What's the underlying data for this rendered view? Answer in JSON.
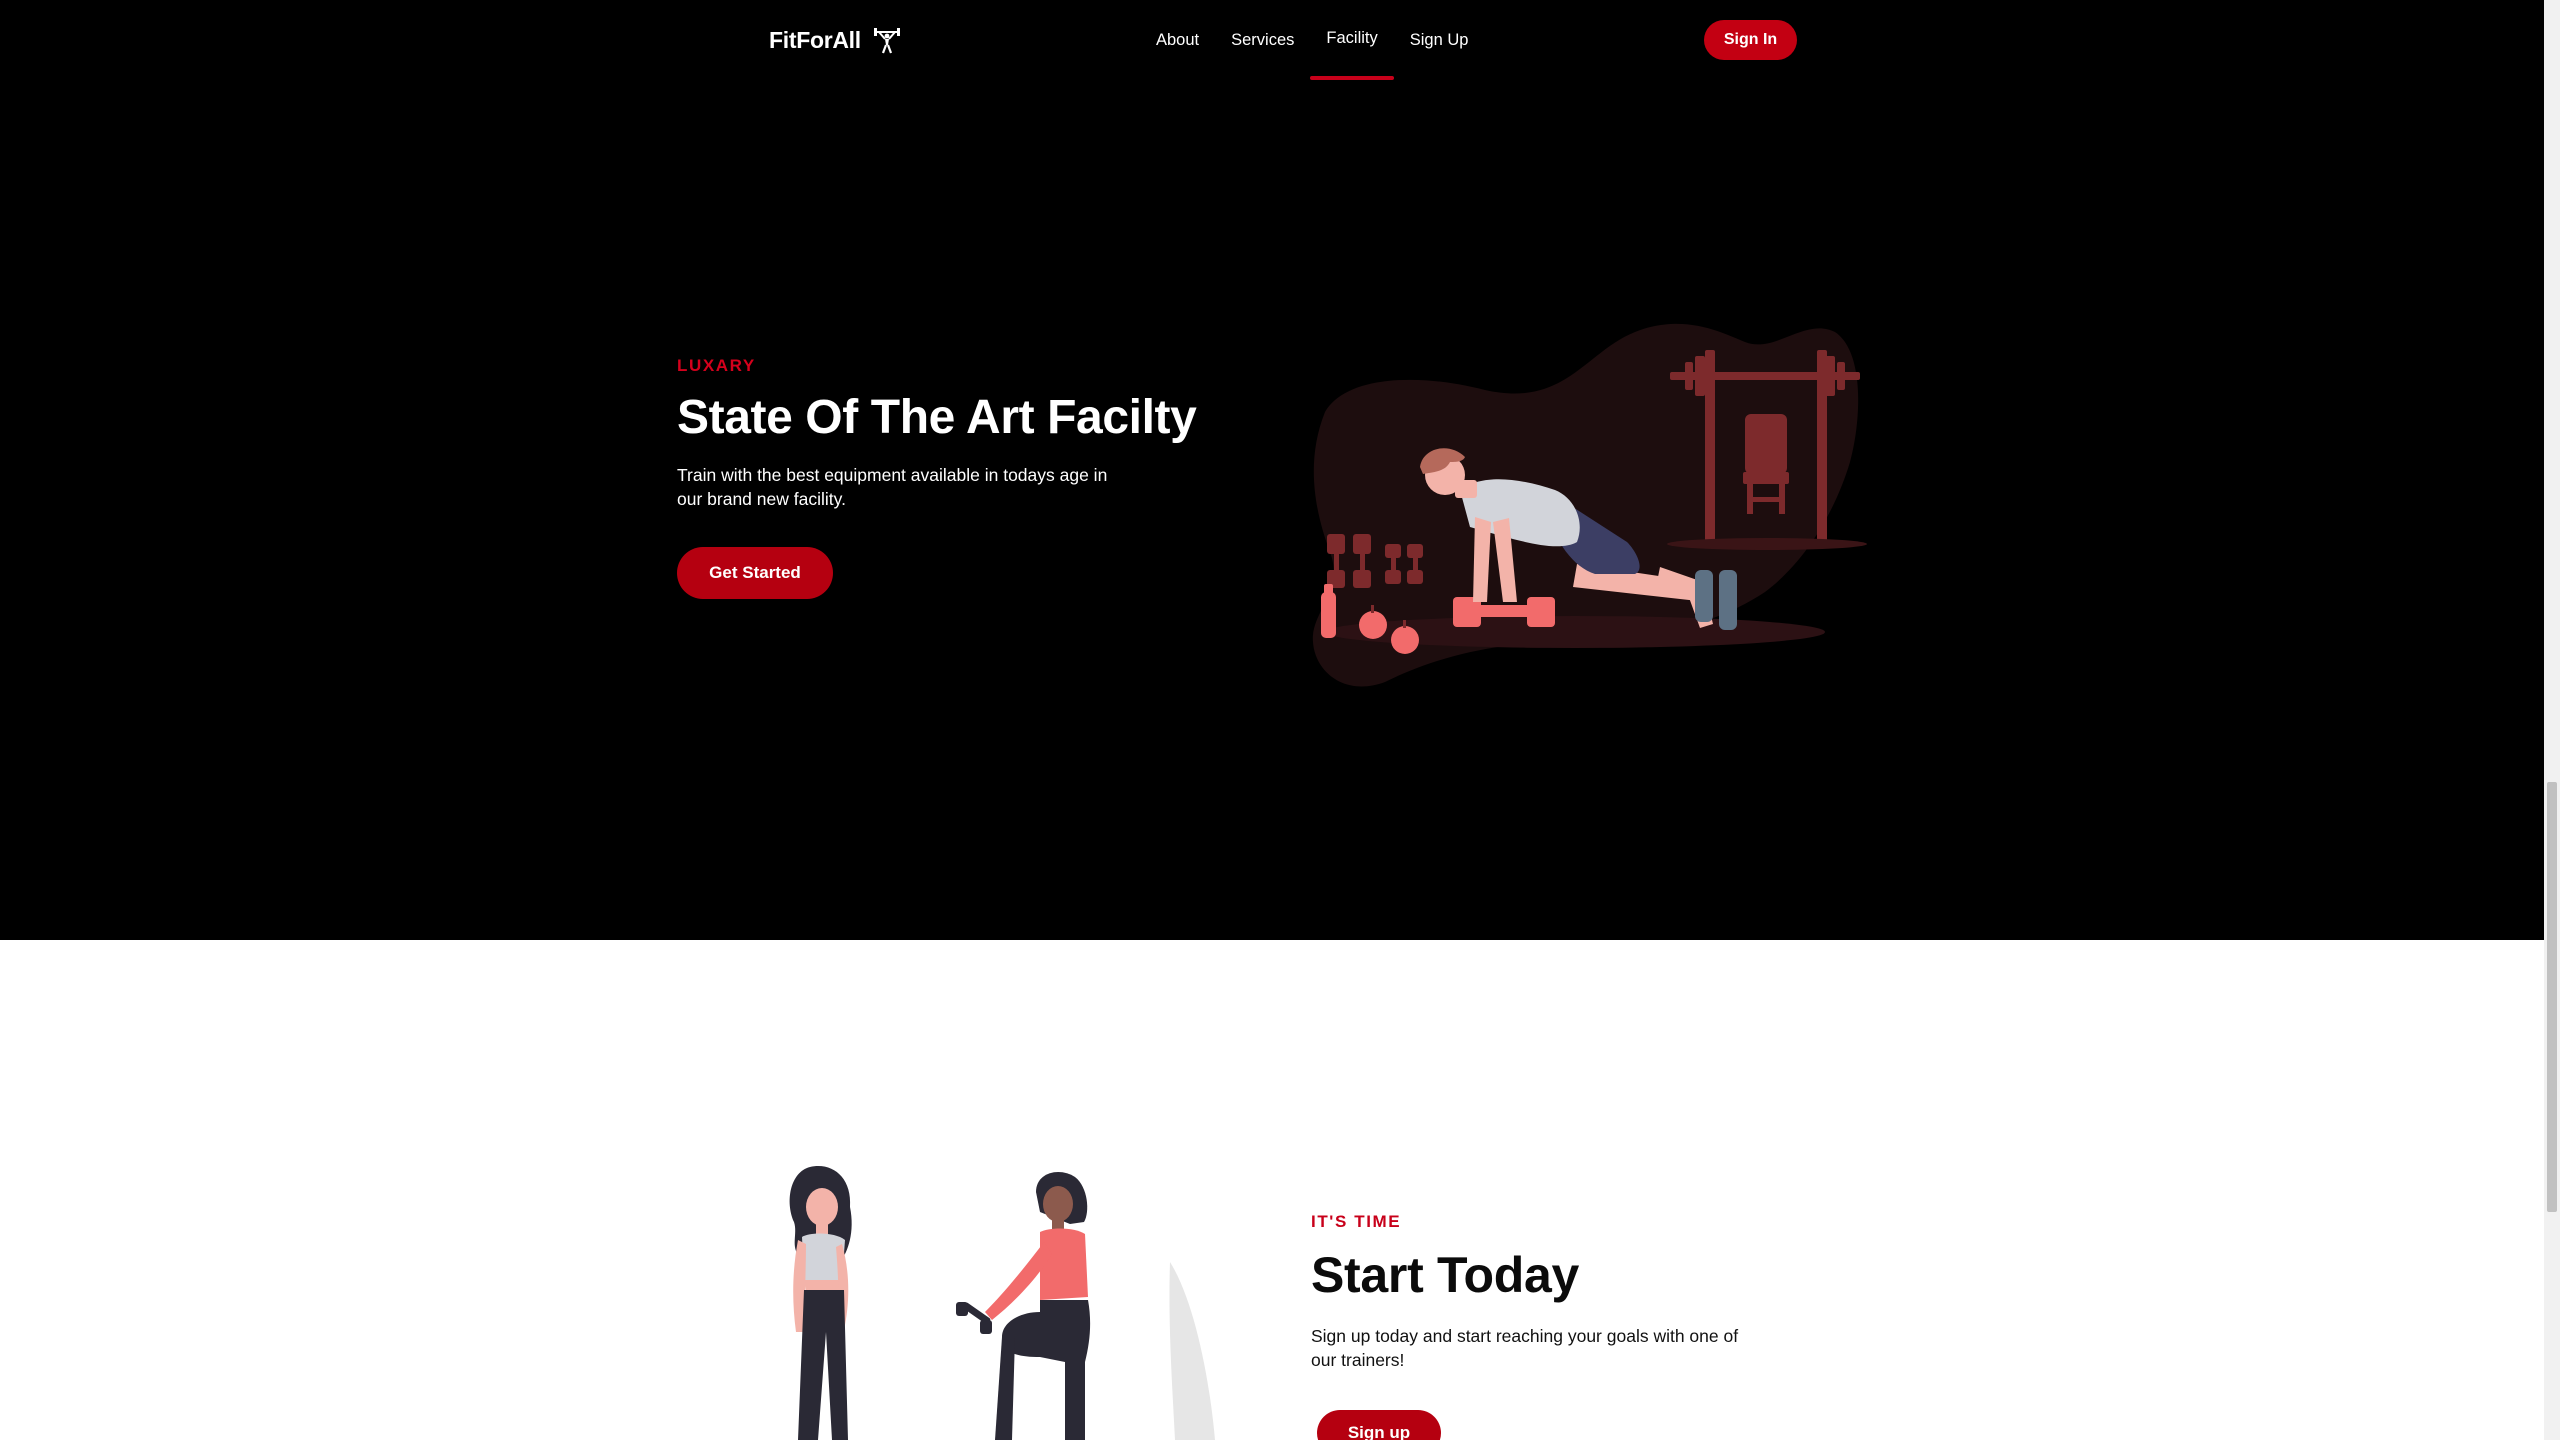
{
  "navbar": {
    "brand": "FitForAll",
    "brand_icon": "weightlifter-icon",
    "links": [
      {
        "label": "About",
        "active": false
      },
      {
        "label": "Services",
        "active": false
      },
      {
        "label": "Facility",
        "active": true
      },
      {
        "label": "Sign Up",
        "active": false
      }
    ],
    "signin_label": "Sign In"
  },
  "hero": {
    "eyebrow": "LUXARY",
    "title": "State Of The Art Facilty",
    "description": "Train with the best equipment available in todays age in our brand new facility.",
    "button_label": "Get Started"
  },
  "start": {
    "eyebrow": "IT'S TIME",
    "title": "Start Today",
    "description": "Sign up today and start reaching your goals with one of our trainers!",
    "button_label": "Sign up"
  },
  "colors": {
    "accent": "#c30012",
    "hero_background": "#000000",
    "illustration_red": "#f26b6b",
    "illustration_dark_red": "#8a2c2c"
  }
}
